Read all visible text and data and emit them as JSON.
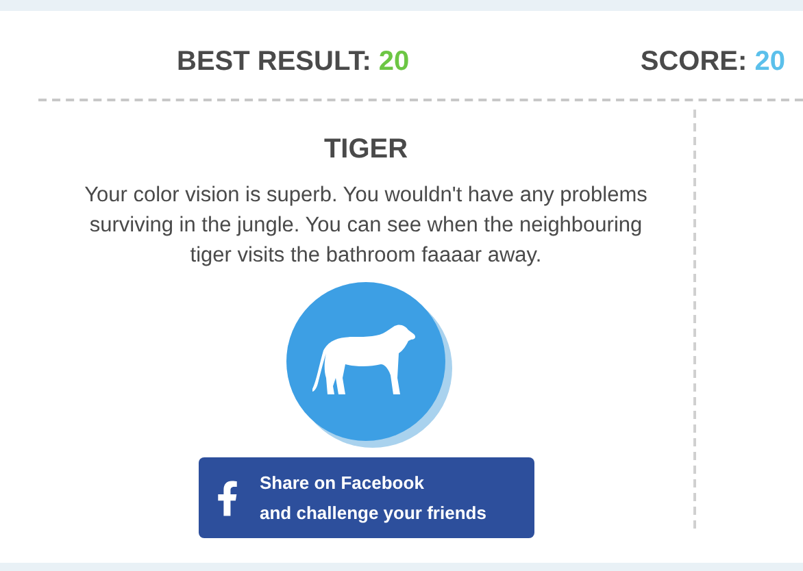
{
  "scores": [
    {
      "label": "BEST RESULT:",
      "value": "20",
      "color": "#6cc644"
    },
    {
      "label": "SCORE:",
      "value": "20",
      "color": "#5bc0eb"
    }
  ],
  "result": {
    "title": "TIGER",
    "description": "Your color vision is superb. You wouldn't have any problems surviving in the jungle. You can see when the neighbouring tiger visits the bathroom faaaar away."
  },
  "share_button": {
    "lines": [
      "Share on Facebook",
      "and challenge your friends"
    ]
  }
}
